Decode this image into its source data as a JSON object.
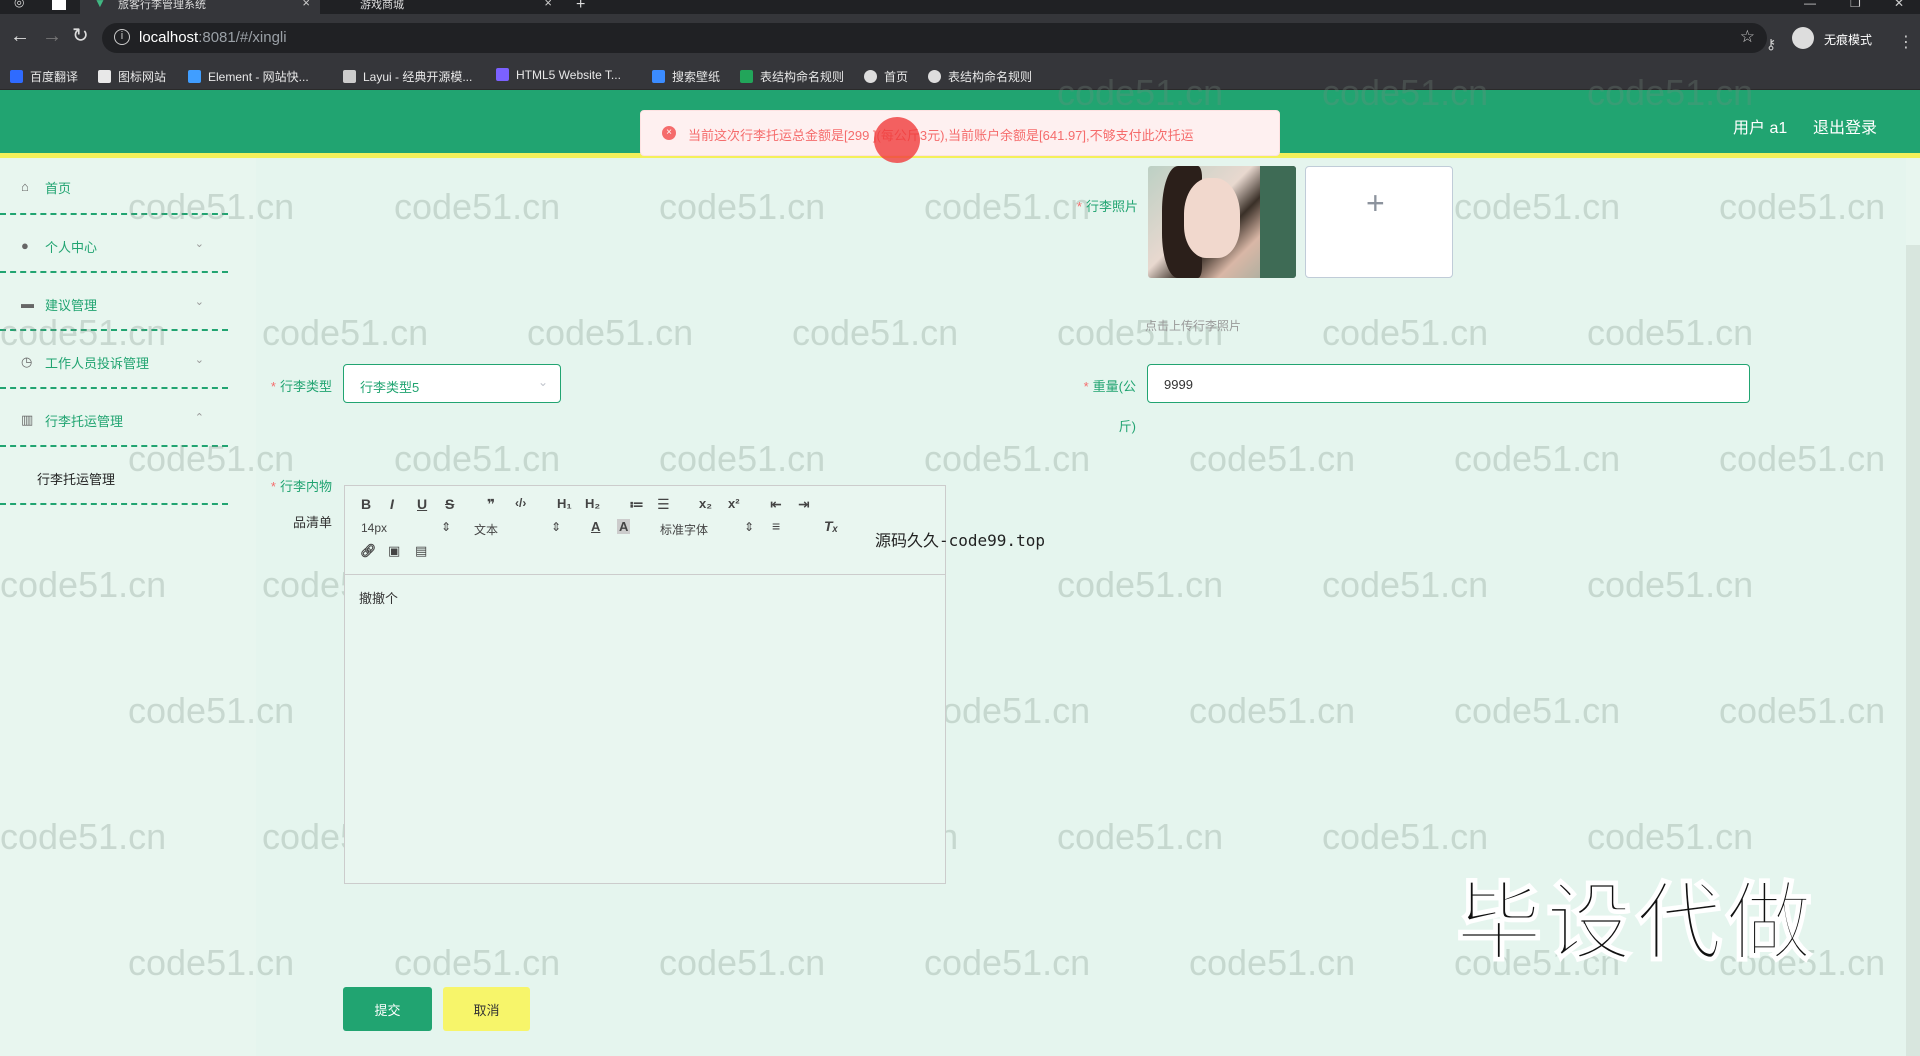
{
  "browser": {
    "tabs": [
      {
        "label": "旅客行李管理系统",
        "active": true
      },
      {
        "label": "游戏商城",
        "active": false
      }
    ],
    "new_tab": "+",
    "url_host": "localhost",
    "url_rest": ":8081/#/xingli",
    "incognito_label": "无痕模式",
    "bookmarks": [
      {
        "label": "百度翻译",
        "icon": "translate-icon",
        "color": "#2f6bff"
      },
      {
        "label": "图标网站",
        "icon": "flag-icon",
        "color": "#e8e8e8"
      },
      {
        "label": "Element - 网站快...",
        "icon": "element-icon",
        "color": "#409eff"
      },
      {
        "label": "Layui - 经典开源模...",
        "icon": "layui-icon",
        "color": "#ccc"
      },
      {
        "label": "HTML5 Website T...",
        "icon": "html5-icon",
        "color": "#7b61ff"
      },
      {
        "label": "搜索壁纸",
        "icon": "wallpaper-icon",
        "color": "#3b8cff"
      },
      {
        "label": "表结构命名规则",
        "icon": "sheet-icon",
        "color": "#22a55a"
      },
      {
        "label": "首页",
        "icon": "globe-icon",
        "color": "#ddd"
      },
      {
        "label": "表结构命名规则",
        "icon": "globe-icon",
        "color": "#ddd"
      }
    ]
  },
  "header": {
    "user": "用户 a1",
    "logout": "退出登录",
    "message": "当前这次行李托运总金额是[299   ](每公斤3元),当前账户余额是[641.97],不够支付此次托运"
  },
  "sidebar": {
    "items": [
      {
        "label": "首页",
        "icon": "home-icon",
        "chevron": ""
      },
      {
        "label": "个人中心",
        "icon": "user-icon",
        "chevron": "⌄"
      },
      {
        "label": "建议管理",
        "icon": "suggest-icon",
        "chevron": "⌄"
      },
      {
        "label": "工作人员投诉管理",
        "icon": "clock-icon",
        "chevron": "⌄"
      },
      {
        "label": "行李托运管理",
        "icon": "luggage-icon",
        "chevron": "⌃"
      }
    ],
    "sub_item": "行李托运管理"
  },
  "form": {
    "photo_label": "行李照片",
    "photo_hint": "点击上传行李照片",
    "type_label": "行李类型",
    "type_value": "行李类型5",
    "weight_label_1": "重量(公",
    "weight_label_2": "斤)",
    "weight_value": "9999",
    "contents_label_1": "行李内物",
    "contents_label_2": "品清单",
    "editor_font_size": "14px",
    "editor_text_type": "文本",
    "editor_font_family": "标准字体",
    "editor_content": "撤撤个",
    "submit": "提交",
    "cancel": "取消"
  },
  "overlay": {
    "source_text": "源码久久-code99.top",
    "big_text": "毕设代做",
    "watermark": "code51.cn"
  }
}
